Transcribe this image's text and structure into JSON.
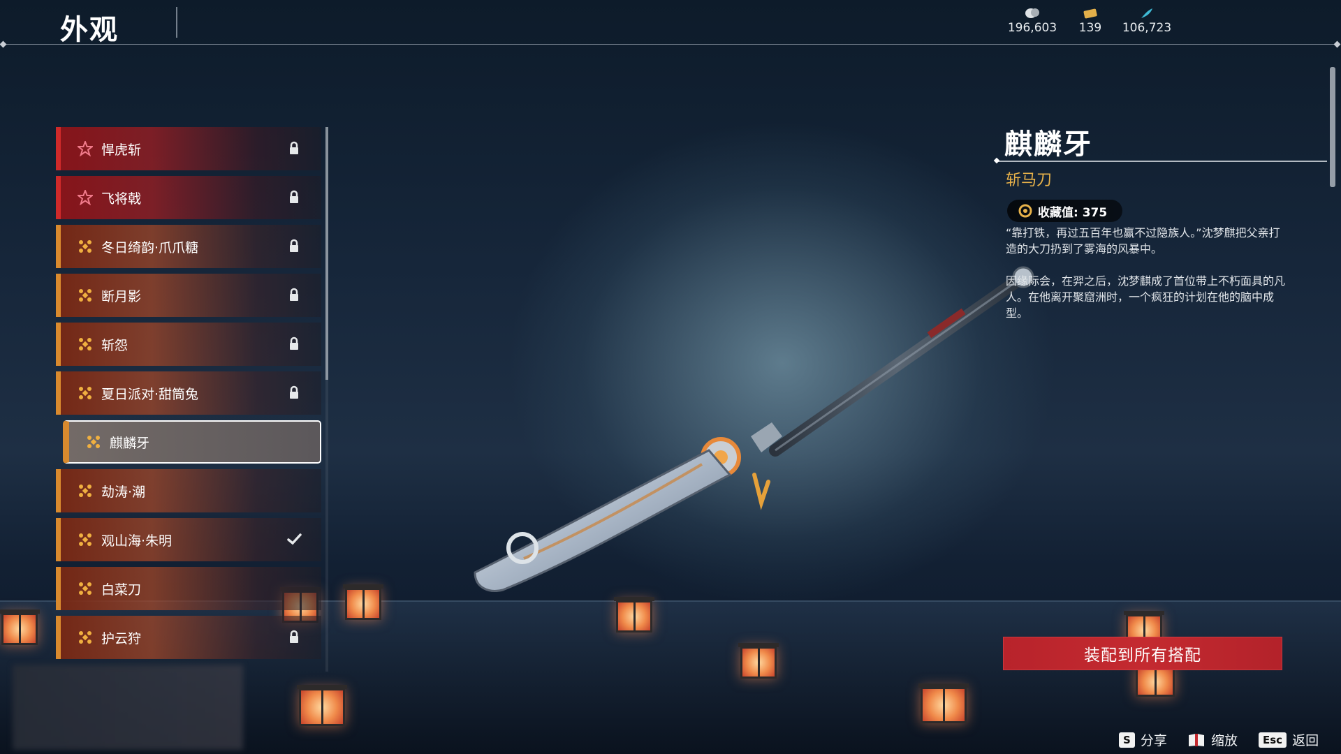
{
  "header": {
    "title": "外观",
    "currencies": [
      {
        "icon": "coin-icon",
        "value": "196,603"
      },
      {
        "icon": "ticket-icon",
        "value": "139"
      },
      {
        "icon": "feather-icon",
        "value": "106,723"
      }
    ]
  },
  "skins": [
    {
      "name": "悍虎斩",
      "rarity": "red-star-icon",
      "state": "lock-icon"
    },
    {
      "name": "飞将戟",
      "rarity": "red-star-icon",
      "state": "lock-icon"
    },
    {
      "name": "冬日绮韵·爪爪糖",
      "rarity": "gold-emblem-icon",
      "state": "lock-icon"
    },
    {
      "name": "断月影",
      "rarity": "gold-emblem-icon",
      "state": "lock-icon"
    },
    {
      "name": "斩怨",
      "rarity": "gold-emblem-icon",
      "state": "lock-icon"
    },
    {
      "name": "夏日派对·甜筒兔",
      "rarity": "gold-emblem-icon",
      "state": "lock-icon"
    },
    {
      "name": "麒麟牙",
      "rarity": "gold-emblem-icon",
      "state": "",
      "selected": true
    },
    {
      "name": "劫涛·潮",
      "rarity": "gold-emblem-icon",
      "state": ""
    },
    {
      "name": "观山海·朱明",
      "rarity": "gold-emblem-icon",
      "state": "check-icon"
    },
    {
      "name": "白菜刀",
      "rarity": "gold-emblem-icon",
      "state": ""
    },
    {
      "name": "护云狩",
      "rarity": "gold-emblem-icon",
      "state": "lock-icon"
    }
  ],
  "detail": {
    "name": "麒麟牙",
    "type": "斩马刀",
    "collection_label": "收藏值: 375",
    "desc1": "“靠打铁，再过五百年也赢不过隐族人。”沈梦麒把父亲打造的大刀扔到了雾海的风暴中。",
    "desc2": "因缘际会，在羿之后，沈梦麒成了首位带上不朽面具的凡人。在他离开聚窟洲时，一个疯狂的计划在他的脑中成型。",
    "equip_button": "装配到所有搭配"
  },
  "hints": [
    {
      "key": "S",
      "label": "分享"
    },
    {
      "key": "",
      "label": "缩放",
      "icon": "book-icon"
    },
    {
      "key": "Esc",
      "label": "返回"
    }
  ],
  "colors": {
    "accent_red": "#c42a30",
    "gold": "#e8b24a",
    "rarity_gold": "#d98a2e",
    "rarity_red": "#cf2a2a"
  }
}
